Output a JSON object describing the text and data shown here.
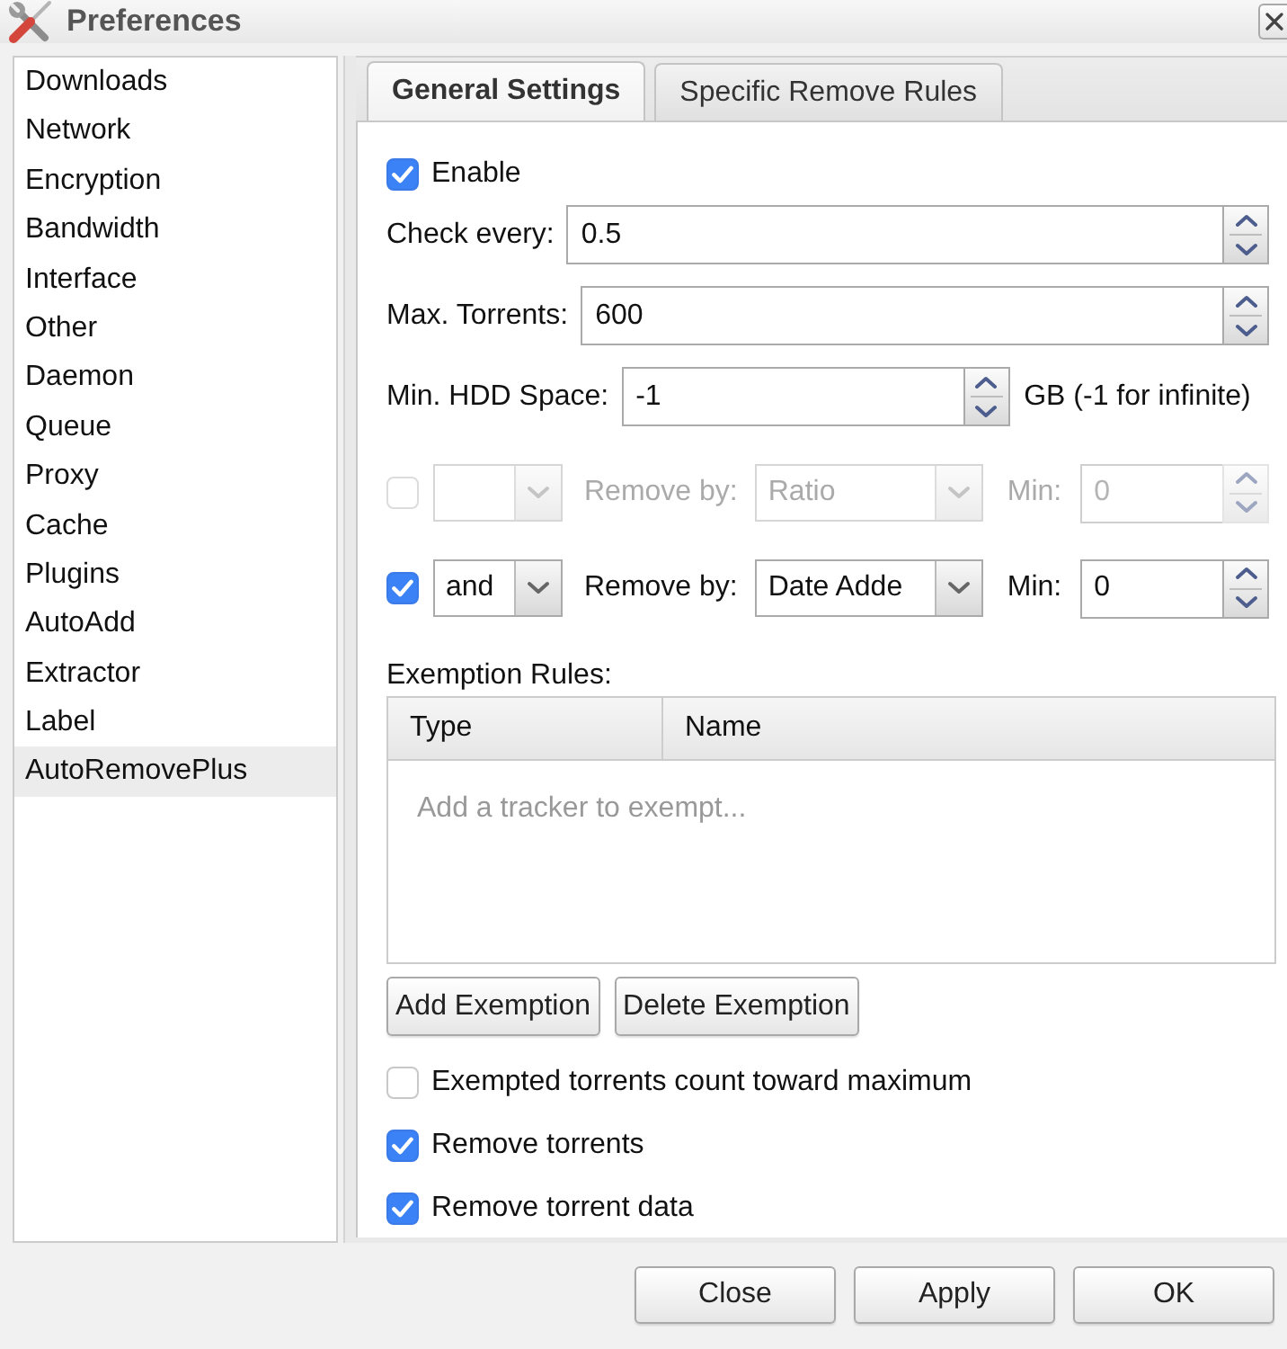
{
  "window": {
    "title": "Preferences"
  },
  "sidebar": {
    "items": [
      {
        "label": "Downloads",
        "selected": false
      },
      {
        "label": "Network",
        "selected": false
      },
      {
        "label": "Encryption",
        "selected": false
      },
      {
        "label": "Bandwidth",
        "selected": false
      },
      {
        "label": "Interface",
        "selected": false
      },
      {
        "label": "Other",
        "selected": false
      },
      {
        "label": "Daemon",
        "selected": false
      },
      {
        "label": "Queue",
        "selected": false
      },
      {
        "label": "Proxy",
        "selected": false
      },
      {
        "label": "Cache",
        "selected": false
      },
      {
        "label": "Plugins",
        "selected": false
      },
      {
        "label": "AutoAdd",
        "selected": false
      },
      {
        "label": "Extractor",
        "selected": false
      },
      {
        "label": "Label",
        "selected": false
      },
      {
        "label": "AutoRemovePlus",
        "selected": true
      }
    ]
  },
  "tabs": [
    {
      "label": "General Settings",
      "selected": true
    },
    {
      "label": "Specific Remove Rules",
      "selected": false
    }
  ],
  "general": {
    "enable": {
      "label": "Enable",
      "checked": true
    },
    "fields": [
      {
        "label": "Check every:",
        "value": "0.5"
      },
      {
        "label": "Max. Torrents:",
        "value": "600"
      },
      {
        "label": "Min. HDD Space:",
        "value": "-1",
        "suffix": "GB (-1 for infinite)"
      }
    ],
    "rules": [
      {
        "checked": false,
        "disabled": true,
        "remove_by_label": "Remove by:",
        "remove_by": "Ratio",
        "min_label": "Min:",
        "min": "0"
      },
      {
        "checked": true,
        "disabled": false,
        "operator": "and",
        "remove_by_label": "Remove by:",
        "remove_by": "Date Adde",
        "min_label": "Min:",
        "min": "0"
      }
    ],
    "exemptions": {
      "label": "Exemption Rules:",
      "columns": [
        "Type",
        "Name"
      ],
      "empty_text": "Add a tracker to exempt...",
      "buttons": [
        "Add Exemption",
        "Delete Exemption"
      ]
    },
    "options": [
      {
        "label": "Exempted torrents count toward maximum",
        "checked": false
      },
      {
        "label": "Remove torrents",
        "checked": true
      },
      {
        "label": "Remove torrent data",
        "checked": true
      }
    ]
  },
  "buttons": [
    "Close",
    "Apply",
    "OK"
  ]
}
